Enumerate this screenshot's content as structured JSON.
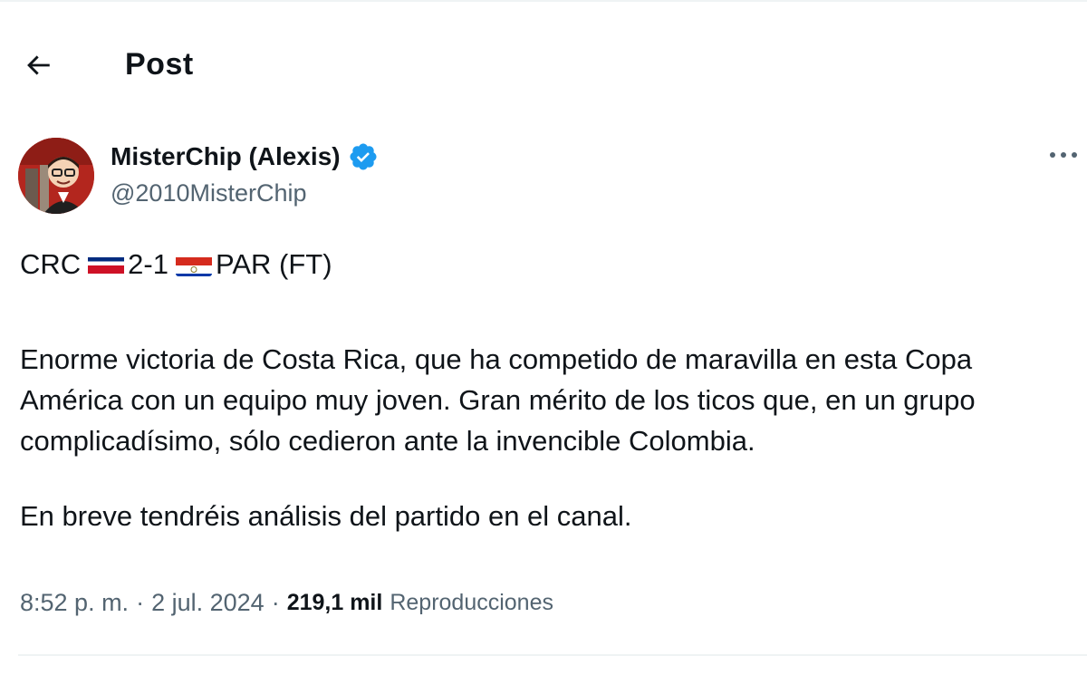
{
  "header": {
    "title": "Post"
  },
  "author": {
    "display_name": "MisterChip (Alexis)",
    "handle": "@2010MisterChip",
    "verified": true,
    "verified_color": "#1d9bf0"
  },
  "tweet": {
    "score": {
      "home": "CRC",
      "result": "2-1",
      "away": "PAR (FT)"
    },
    "paragraph1": "Enorme victoria de Costa Rica, que ha competido de maravilla en esta Copa América con un equipo muy joven. Gran mérito de los ticos que, en un grupo complicadísimo, sólo cedieron ante la invencible Colombia.",
    "paragraph2": "En breve tendréis análisis del partido en el canal."
  },
  "meta": {
    "time": "8:52 p. m.",
    "separator": "·",
    "date": "2 jul. 2024",
    "views_count": "219,1 mil",
    "views_label": "Reproducciones"
  },
  "icons": {
    "back": "arrow-left-icon",
    "verified": "verified-badge-icon",
    "more": "more-horizontal-icon",
    "flag_home": "costa-rica-flag-icon",
    "flag_away": "paraguay-flag-icon"
  },
  "colors": {
    "text_primary": "#0f1419",
    "text_secondary": "#536471",
    "divider": "#eff3f4"
  }
}
